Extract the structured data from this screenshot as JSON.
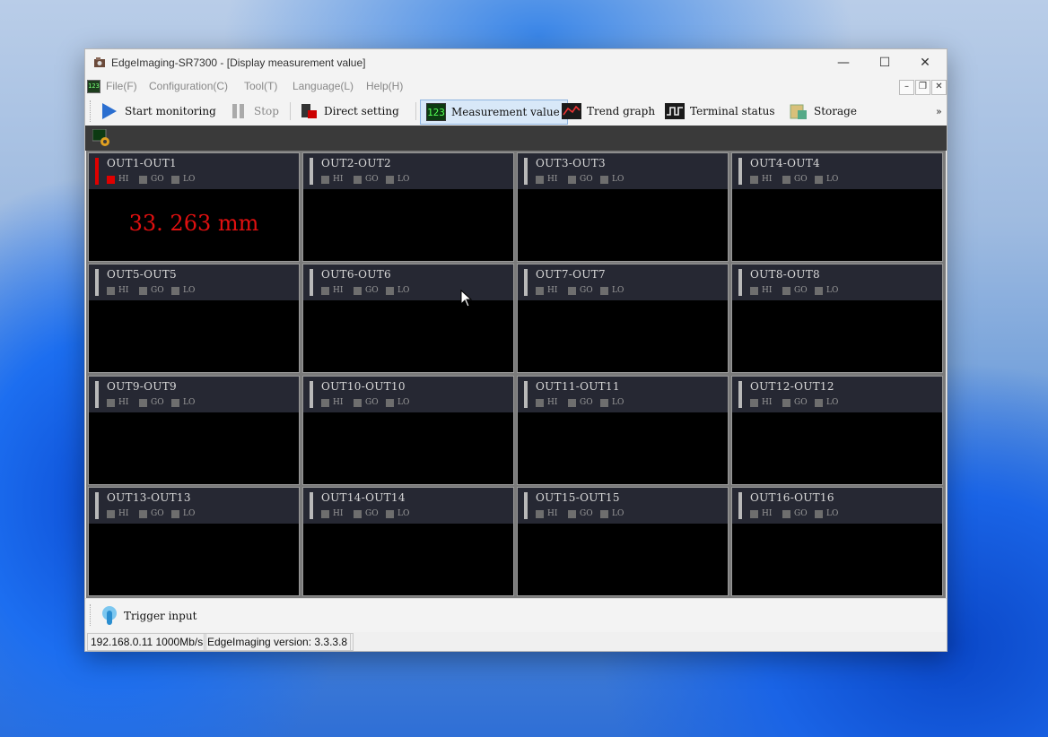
{
  "window": {
    "title": "EdgeImaging-SR7300 - [Display measurement value]",
    "minimize": "—",
    "maximize": "☐",
    "close": "✕"
  },
  "menu": {
    "items": [
      {
        "label": "File(F)"
      },
      {
        "label": "Configuration(C)"
      },
      {
        "label": "Tool(T)"
      },
      {
        "label": "Language(L)"
      },
      {
        "label": "Help(H)"
      }
    ],
    "mdi": {
      "minimize": "–",
      "restore": "❐",
      "close": "✕"
    }
  },
  "toolbar": {
    "start_monitoring": "Start monitoring",
    "stop": "Stop",
    "direct_setting": "Direct setting",
    "measurement_value": "Measurement value",
    "trend_graph": "Trend graph",
    "terminal_status": "Terminal status",
    "storage": "Storage",
    "overflow": "»",
    "measurement_icon_text": "123"
  },
  "judge_labels": {
    "hi": "HI",
    "go": "GO",
    "lo": "LO"
  },
  "outputs": [
    {
      "title": "OUT1-OUT1",
      "value": "33. 263  mm",
      "hi_on": true
    },
    {
      "title": "OUT2-OUT2",
      "value": "",
      "hi_on": false
    },
    {
      "title": "OUT3-OUT3",
      "value": "",
      "hi_on": false
    },
    {
      "title": "OUT4-OUT4",
      "value": "",
      "hi_on": false
    },
    {
      "title": "OUT5-OUT5",
      "value": "",
      "hi_on": false
    },
    {
      "title": "OUT6-OUT6",
      "value": "",
      "hi_on": false
    },
    {
      "title": "OUT7-OUT7",
      "value": "",
      "hi_on": false
    },
    {
      "title": "OUT8-OUT8",
      "value": "",
      "hi_on": false
    },
    {
      "title": "OUT9-OUT9",
      "value": "",
      "hi_on": false
    },
    {
      "title": "OUT10-OUT10",
      "value": "",
      "hi_on": false
    },
    {
      "title": "OUT11-OUT11",
      "value": "",
      "hi_on": false
    },
    {
      "title": "OUT12-OUT12",
      "value": "",
      "hi_on": false
    },
    {
      "title": "OUT13-OUT13",
      "value": "",
      "hi_on": false
    },
    {
      "title": "OUT14-OUT14",
      "value": "",
      "hi_on": false
    },
    {
      "title": "OUT15-OUT15",
      "value": "",
      "hi_on": false
    },
    {
      "title": "OUT16-OUT16",
      "value": "",
      "hi_on": false
    }
  ],
  "bottom": {
    "trigger_input": "Trigger input"
  },
  "status": {
    "network": "192.168.0.11 1000Mb/s",
    "version": "EdgeImaging version: 3.3.3.8"
  },
  "colors": {
    "alarm": "#e00000",
    "value_text": "#e01010",
    "panel_bg": "#000000"
  }
}
